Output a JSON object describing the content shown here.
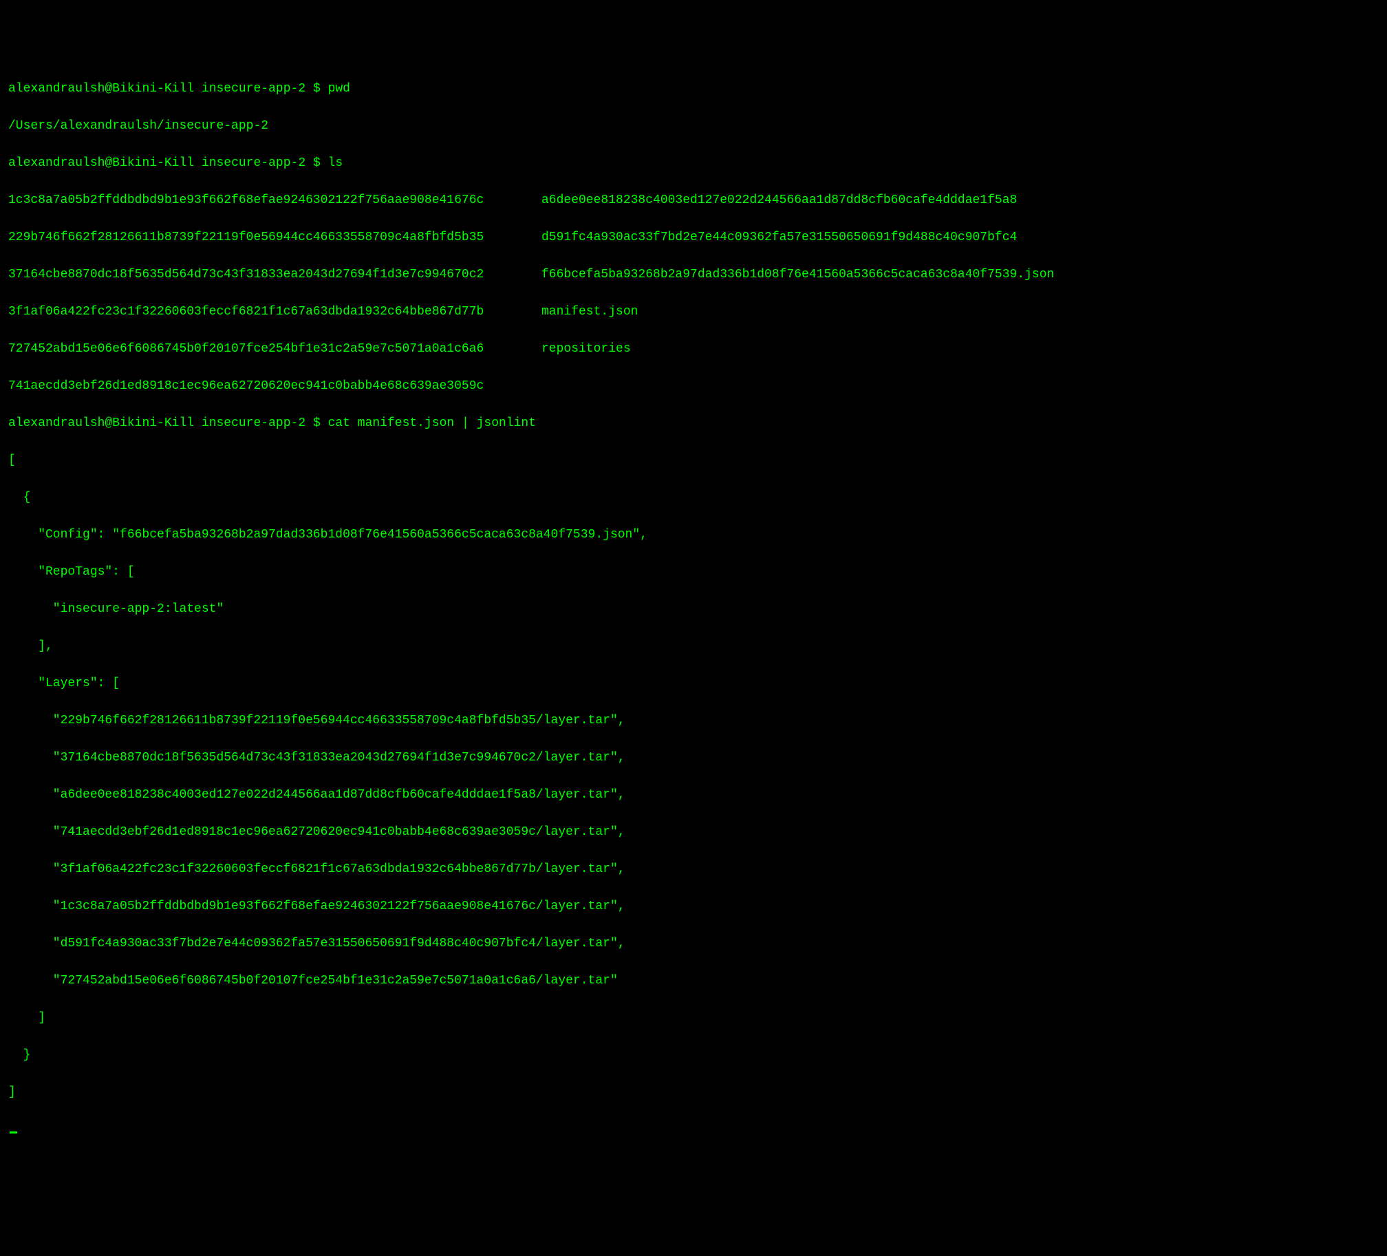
{
  "prompt_user": "alexandraulsh",
  "prompt_host": "Bikini-Kill",
  "prompt_dir": "insecure-app-2",
  "prompt_symbol": "$",
  "commands": {
    "pwd": "pwd",
    "pwd_output": "/Users/alexandraulsh/insecure-app-2",
    "ls": "ls",
    "cat": "cat manifest.json | jsonlint"
  },
  "ls_left": [
    "1c3c8a7a05b2ffddbdbd9b1e93f662f68efae9246302122f756aae908e41676c",
    "229b746f662f28126611b8739f22119f0e56944cc46633558709c4a8fbfd5b35",
    "37164cbe8870dc18f5635d564d73c43f31833ea2043d27694f1d3e7c994670c2",
    "3f1af06a422fc23c1f32260603feccf6821f1c67a63dbda1932c64bbe867d77b",
    "727452abd15e06e6f6086745b0f20107fce254bf1e31c2a59e7c5071a0a1c6a6",
    "741aecdd3ebf26d1ed8918c1ec96ea62720620ec941c0babb4e68c639ae3059c"
  ],
  "ls_right": [
    "a6dee0ee818238c4003ed127e022d244566aa1d87dd8cfb60cafe4dddae1f5a8",
    "d591fc4a930ac33f7bd2e7e44c09362fa57e31550650691f9d488c40c907bfc4",
    "f66bcefa5ba93268b2a97dad336b1d08f76e41560a5366c5caca63c8a40f7539.json",
    "manifest.json",
    "repositories"
  ],
  "json_lines": [
    "[",
    "  {",
    "    \"Config\": \"f66bcefa5ba93268b2a97dad336b1d08f76e41560a5366c5caca63c8a40f7539.json\",",
    "    \"RepoTags\": [",
    "      \"insecure-app-2:latest\"",
    "    ],",
    "    \"Layers\": [",
    "      \"229b746f662f28126611b8739f22119f0e56944cc46633558709c4a8fbfd5b35/layer.tar\",",
    "      \"37164cbe8870dc18f5635d564d73c43f31833ea2043d27694f1d3e7c994670c2/layer.tar\",",
    "      \"a6dee0ee818238c4003ed127e022d244566aa1d87dd8cfb60cafe4dddae1f5a8/layer.tar\",",
    "      \"741aecdd3ebf26d1ed8918c1ec96ea62720620ec941c0babb4e68c639ae3059c/layer.tar\",",
    "      \"3f1af06a422fc23c1f32260603feccf6821f1c67a63dbda1932c64bbe867d77b/layer.tar\",",
    "      \"1c3c8a7a05b2ffddbdbd9b1e93f662f68efae9246302122f756aae908e41676c/layer.tar\",",
    "      \"d591fc4a930ac33f7bd2e7e44c09362fa57e31550650691f9d488c40c907bfc4/layer.tar\",",
    "      \"727452abd15e06e6f6086745b0f20107fce254bf1e31c2a59e7c5071a0a1c6a6/layer.tar\"",
    "    ]",
    "  }",
    "]"
  ]
}
